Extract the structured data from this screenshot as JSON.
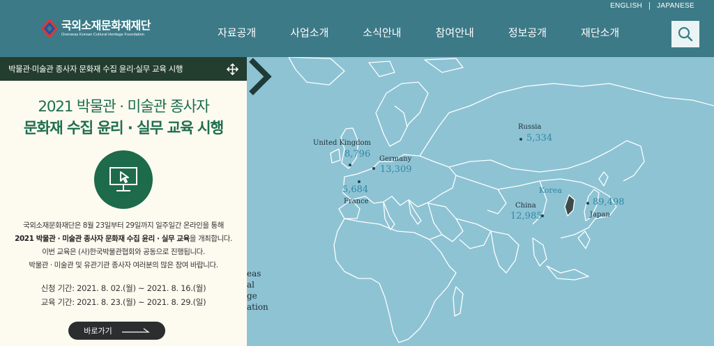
{
  "header": {
    "logo_kr": "국외소재문화재재단",
    "logo_en": "Overseas Korean Cultural Heritage Foundation",
    "lang": [
      "ENGLISH",
      "JAPANESE"
    ],
    "nav": [
      "자료공개",
      "사업소개",
      "소식안내",
      "참여안내",
      "정보공개",
      "재단소개"
    ],
    "search_icon": "search-icon"
  },
  "popup": {
    "bar_title": "박물관·미술관 종사자 문화재 수집 윤리·실무 교육 시행",
    "heading_line1": "2021 박물관 · 미술관 종사자",
    "heading_line2": "문화재 수집 윤리 · 실무 교육 시행",
    "badge_icon": "monitor-cursor-icon",
    "body_line1": "국외소재문화재단은 8월 23일부터 29일까지 일주일간 온라인을 통해",
    "body_line2_bold": "2021 박물관 · 미술관 종사자 문화재 수집 윤리 · 실무 교육",
    "body_line2_rest": "을 개최합니다.",
    "body_line3": "이번 교육은 (사)한국박물관협회와 공동으로 진행됩니다.",
    "body_line4": "박물관 · 미술관 및 유관기관 종사자 여러분의 많은 참여 바랍니다.",
    "date_apply": "신청 기간: 2021. 8. 02.(월) ~ 2021. 8. 16.(월)",
    "date_edu": "교육 기간: 2021. 8. 23.(월) ~ 2021. 8. 29.(일)",
    "go_button": "바로가기"
  },
  "map": {
    "countries": [
      {
        "name": "United Kingdom",
        "count": "8,796"
      },
      {
        "name": "Germany",
        "count": "13,309"
      },
      {
        "name": "France",
        "count": "5,684"
      },
      {
        "name": "Russia",
        "count": "5,334"
      },
      {
        "name": "China",
        "count": "12,985"
      },
      {
        "name": "Japan",
        "count": "89,498"
      }
    ],
    "korea_label": "Korea",
    "legend_peek": [
      "eas",
      "",
      "al",
      "ge",
      "ation"
    ],
    "colors": {
      "ocean": "#8ec3d4",
      "land": "#8ec3d4",
      "border": "#ffffff",
      "korea": "#3c4c4a"
    }
  }
}
